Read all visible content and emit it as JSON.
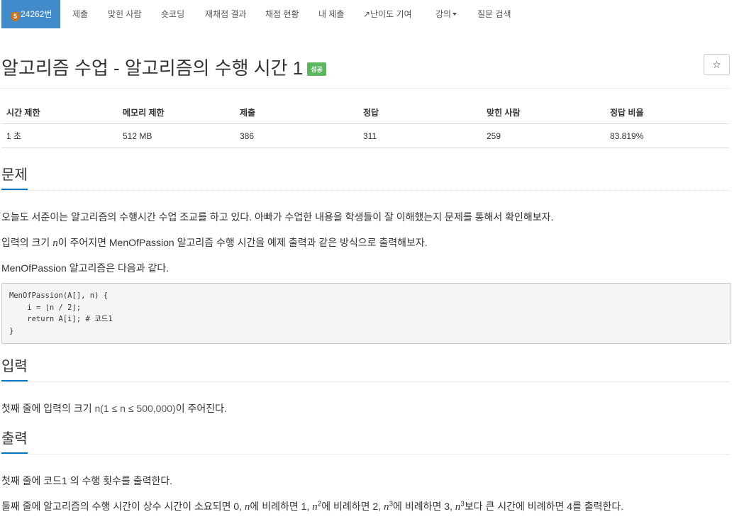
{
  "nav": {
    "problem_number": "24262번",
    "tabs": [
      "제출",
      "맞힌 사람",
      "숏코딩",
      "재채점 결과",
      "채점 현황",
      "내 제출",
      "난이도 기여",
      "강의",
      "질문 검색"
    ]
  },
  "problem": {
    "title": "알고리즘 수업 - 알고리즘의 수행 시간 1",
    "status_badge": "성공",
    "star_icon": "☆"
  },
  "info_table": {
    "headers": [
      "시간 제한",
      "메모리 제한",
      "제출",
      "정답",
      "맞힌 사람",
      "정답 비율"
    ],
    "values": [
      "1 초",
      "512 MB",
      "386",
      "311",
      "259",
      "83.819%"
    ]
  },
  "sections": {
    "description_title": "문제",
    "description_p1": "오늘도 서준이는 알고리즘의 수행시간 수업 조교를 하고 있다. 아빠가 수업한 내용을 학생들이 잘 이해했는지 문제를 통해서 확인해보자.",
    "description_p2_pre": "입력의 크기 ",
    "description_p2_var": "n",
    "description_p2_post": "이 주어지면 MenOfPassion 알고리즘 수행 시간을 예제 출력과 같은 방식으로 출력해보자.",
    "description_p3": "MenOfPassion 알고리즘은 다음과 같다.",
    "code": "MenOfPassion(A[], n) {\n    i = ⌊n / 2⌋;\n    return A[i]; # 코드1\n}",
    "input_title": "입력",
    "input_pre": "첫째 줄에 입력의 크기 ",
    "input_math": "n(1 ≤ n ≤ 500,000)",
    "input_post": "이 주어진다.",
    "output_title": "출력",
    "output_p1": "첫째 줄에 코드1 의 수행 횟수를 출력한다.",
    "output_p2_a": "둘째 줄에 알고리즘의 수행 시간이 상수 시간이 소요되면 0, ",
    "output_p2_b": "에 비례하면 1, ",
    "output_p2_c": "에 비례하면 2, ",
    "output_p2_d": "에 비례하면 3, ",
    "output_p2_e": "보다 큰 시간에 비례하면 4를 출력한다.",
    "var_n": "n",
    "exp2": "2",
    "exp3": "3"
  }
}
